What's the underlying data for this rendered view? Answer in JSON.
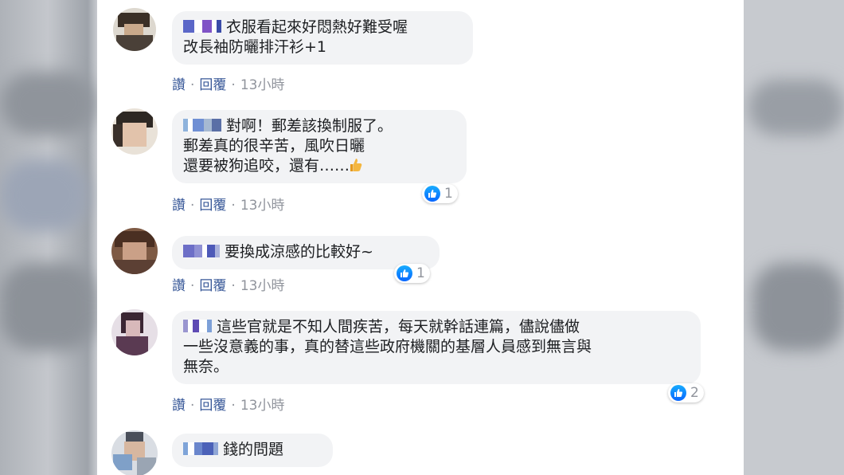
{
  "comments": [
    {
      "text_lines": [
        "衣服看起來好悶熱好難受喔",
        "改長袖防曬排汗衫+1"
      ],
      "like_label": "讚",
      "reply_label": "回覆",
      "time": "13小時",
      "reactions": null
    },
    {
      "text_lines": [
        "對啊！郵差該換制服了。",
        "郵差真的很辛苦，風吹日曬",
        "還要被狗追咬，還有……"
      ],
      "like_label": "讚",
      "reply_label": "回覆",
      "time": "13小時",
      "reactions": "1"
    },
    {
      "text_lines": [
        "要換成涼感的比較好~"
      ],
      "like_label": "讚",
      "reply_label": "回覆",
      "time": "13小時",
      "reactions": "1"
    },
    {
      "text_lines": [
        "這些官就是不知人間疾苦，每天就幹話連篇，儘說儘做",
        "一些沒意義的事，真的替這些政府機關的基層人員感到無言與",
        "無奈。"
      ],
      "like_label": "讚",
      "reply_label": "回覆",
      "time": "13小時",
      "reactions": "2"
    },
    {
      "text_lines": [
        "錢的問題"
      ],
      "like_label": null,
      "reply_label": null,
      "time": null,
      "reactions": null
    }
  ],
  "icons": {
    "like": "thumbs-up-icon",
    "emoji": "thumbs-up-emoji",
    "name": "pixelated-name",
    "avatar": "pixelated-avatar"
  },
  "colors": {
    "link": "#385898",
    "meta": "#90949c",
    "bubble": "#f2f3f5",
    "like_blue": "#1877f2"
  }
}
